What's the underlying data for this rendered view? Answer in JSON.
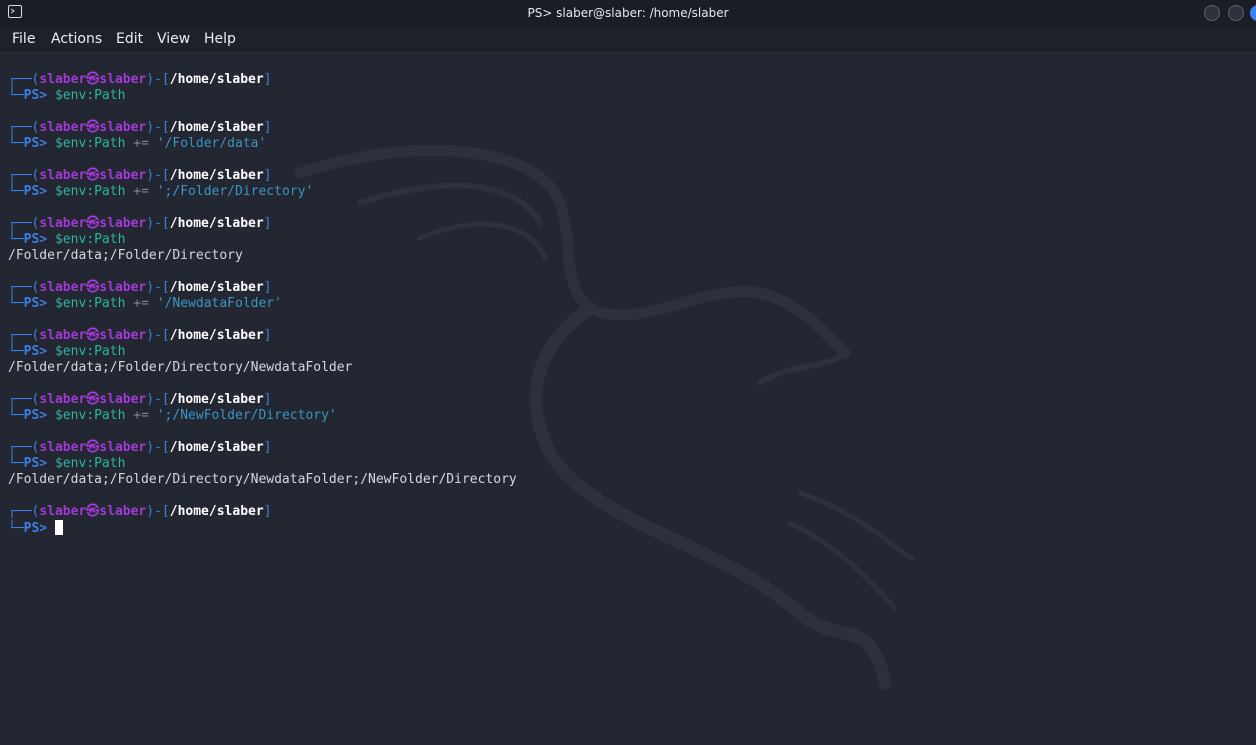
{
  "window": {
    "title": "PS> slaber@slaber: /home/slaber"
  },
  "menu": {
    "items": [
      "File",
      "Actions",
      "Edit",
      "View",
      "Help"
    ]
  },
  "prompt": {
    "open": "┌──(",
    "user": "slaber",
    "at": "㉿",
    "host": "slaber",
    "mid": ")-[",
    "path": "/home/slaber",
    "close": "]",
    "corner": "└─",
    "ps": "PS>"
  },
  "terminal": {
    "entries": [
      {
        "cmd": "$env:Path",
        "op": "",
        "arg": "",
        "output": ""
      },
      {
        "cmd": "$env:Path",
        "op": "+=",
        "arg": "'/Folder/data'",
        "output": ""
      },
      {
        "cmd": "$env:Path",
        "op": "+=",
        "arg": "';/Folder/Directory'",
        "output": ""
      },
      {
        "cmd": "$env:Path",
        "op": "",
        "arg": "",
        "output": "/Folder/data;/Folder/Directory"
      },
      {
        "cmd": "$env:Path",
        "op": "+=",
        "arg": "'/NewdataFolder'",
        "output": ""
      },
      {
        "cmd": "$env:Path",
        "op": "",
        "arg": "",
        "output": "/Folder/data;/Folder/Directory/NewdataFolder"
      },
      {
        "cmd": "$env:Path",
        "op": "+=",
        "arg": "';/NewFolder/Directory'",
        "output": ""
      },
      {
        "cmd": "$env:Path",
        "op": "",
        "arg": "",
        "output": "/Folder/data;/Folder/Directory/NewdataFolder;/NewFolder/Directory"
      },
      {
        "cmd": "",
        "op": "",
        "arg": "",
        "output": ""
      }
    ]
  },
  "icons": {
    "app": "terminal-icon",
    "buttons": [
      "minimize-button",
      "maximize-button",
      "close-button"
    ]
  },
  "colors": {
    "background": "#232731",
    "frame": "#3f7ee5",
    "user": "#a03bd6",
    "command": "#2fb5a3",
    "string": "#3c94c6",
    "close_button": "#3b82f6"
  }
}
